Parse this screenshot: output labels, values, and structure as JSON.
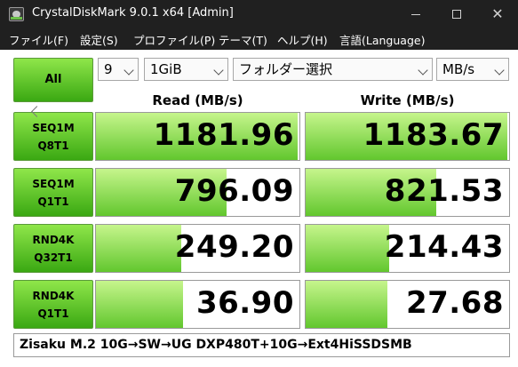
{
  "window": {
    "title": "CrystalDiskMark 9.0.1 x64 [Admin]",
    "close_glyph": "✕"
  },
  "menu": [
    {
      "label": "ファイル(F)"
    },
    {
      "label": "設定(S)"
    },
    {
      "label": "プロファイル(P)"
    },
    {
      "label": "テーマ(T)"
    },
    {
      "label": "ヘルプ(H)"
    },
    {
      "label": "言語(Language)"
    }
  ],
  "controls": {
    "all_label": "All",
    "count": "9",
    "size": "1GiB",
    "folder": "フォルダー選択",
    "unit": "MB/s"
  },
  "headers": {
    "read": "Read (MB/s)",
    "write": "Write (MB/s)"
  },
  "tests": [
    {
      "line1": "SEQ1M",
      "line2": "Q8T1",
      "read": "1181.96",
      "write": "1183.67"
    },
    {
      "line1": "SEQ1M",
      "line2": "Q1T1",
      "read": "796.09",
      "write": "821.53"
    },
    {
      "line1": "RND4K",
      "line2": "Q32T1",
      "read": "249.20",
      "write": "214.43"
    },
    {
      "line1": "RND4K",
      "line2": "Q1T1",
      "read": "36.90",
      "write": "27.68"
    }
  ],
  "bar_fractions": {
    "read": [
      0.99,
      0.64,
      0.42,
      0.43
    ],
    "write": [
      0.99,
      0.64,
      0.41,
      0.4
    ]
  },
  "comment": "Zisaku M.2 10G→SW→UG DXP480T+10G→Ext4HiSSDSMB",
  "colors": {
    "titlebar": "#202020",
    "button_green_top": "#8fe64a",
    "button_green_bottom": "#3aa812",
    "bar_light": "#c6f58c",
    "bar_dark": "#62c72e"
  }
}
